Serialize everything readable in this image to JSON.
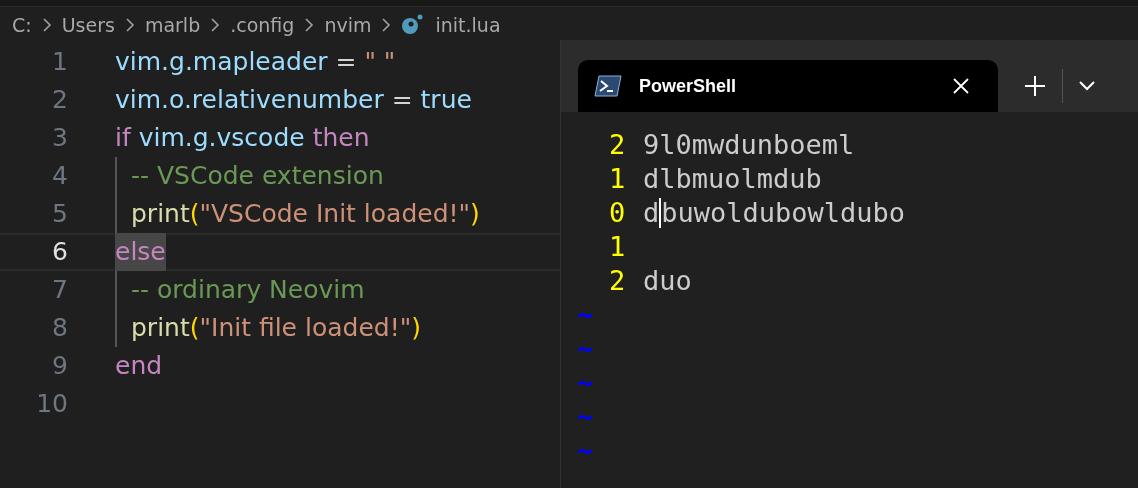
{
  "breadcrumb": [
    {
      "label": "C:"
    },
    {
      "label": "Users"
    },
    {
      "label": "marlb"
    },
    {
      "label": ".config"
    },
    {
      "label": "nvim"
    },
    {
      "label": "init.lua",
      "kind": "lua"
    }
  ],
  "editor": {
    "lines": [
      {
        "number": "1",
        "current": false,
        "tokens": [
          {
            "text": "vim.g.mapleader",
            "kind": "variable"
          },
          {
            "text": " = ",
            "kind": "operator"
          },
          {
            "text": "\" \"",
            "kind": "string"
          }
        ]
      },
      {
        "number": "2",
        "current": false,
        "tokens": [
          {
            "text": "vim.o.relativenumber",
            "kind": "variable"
          },
          {
            "text": " = ",
            "kind": "operator"
          },
          {
            "text": "true",
            "kind": "variable"
          }
        ]
      },
      {
        "number": "3",
        "current": false,
        "tokens": [
          {
            "text": "if",
            "kind": "keyword"
          },
          {
            "text": " vim.g.vscode ",
            "kind": "variable"
          },
          {
            "text": "then",
            "kind": "keyword"
          }
        ],
        "children": [
          {
            "number": "4",
            "current": false,
            "tokens": [
              {
                "text": "-- VSCode extension",
                "kind": "comment"
              }
            ]
          },
          {
            "number": "5",
            "current": false,
            "tokens": [
              {
                "text": "print",
                "kind": "function"
              },
              {
                "text": "(",
                "kind": "bracket"
              },
              {
                "text": "\"VSCode Init loaded!\"",
                "kind": "string"
              },
              {
                "text": ")",
                "kind": "bracket"
              }
            ]
          }
        ]
      },
      {
        "number": "6",
        "current": true,
        "tokens": [
          {
            "text": "else",
            "kind": "keyword"
          }
        ],
        "children": [
          {
            "number": "7",
            "current": false,
            "tokens": [
              {
                "text": "-- ordinary Neovim",
                "kind": "comment"
              }
            ]
          },
          {
            "number": "8",
            "current": false,
            "tokens": [
              {
                "text": "print",
                "kind": "function"
              },
              {
                "text": "(",
                "kind": "bracket"
              },
              {
                "text": "\"Init file loaded!\"",
                "kind": "string"
              },
              {
                "text": ")",
                "kind": "bracket"
              }
            ]
          }
        ]
      },
      {
        "number": "9",
        "current": false,
        "tokens": [
          {
            "text": "end",
            "kind": "keyword"
          }
        ]
      },
      {
        "number": "10",
        "current": false
      }
    ]
  },
  "terminal": {
    "tab": {
      "title": "PowerShell",
      "selected": true
    },
    "rows": [
      {
        "number": "2",
        "text": "9l0mwdunboeml",
        "cursor": false
      },
      {
        "number": "1",
        "text": "dlbmuolmdub",
        "cursor": false
      },
      {
        "number": "0",
        "text": "dbuwoldubowldubo",
        "cursor": true
      },
      {
        "number": "1",
        "text": "",
        "cursor": false
      },
      {
        "number": "2",
        "text": "duo",
        "cursor": false
      }
    ],
    "tildes": [
      "~",
      "~",
      "~",
      "~",
      "~"
    ]
  }
}
